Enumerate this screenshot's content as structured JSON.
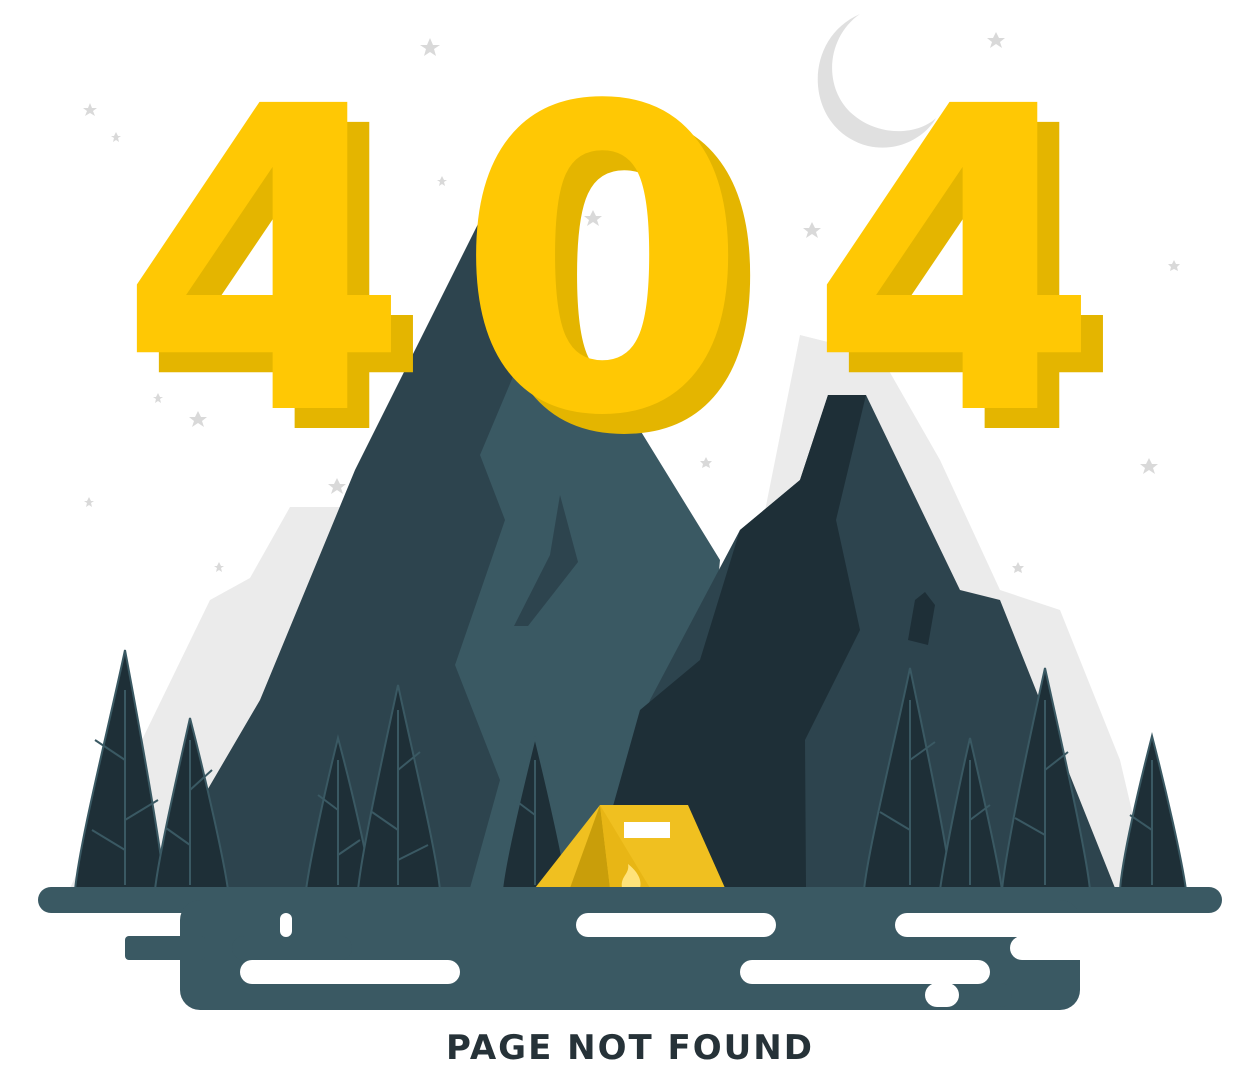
{
  "illustration": {
    "code": [
      "4",
      "0",
      "4"
    ],
    "caption": "PAGE NOT FOUND"
  },
  "colors": {
    "digit": "#ffc804",
    "digit_shadow": "#e4b500",
    "mountain_dark": "#1e2f37",
    "mountain_mid": "#2d444e",
    "mountain_light": "#3a5963",
    "mountain_back": "#ebebeb",
    "ground": "#3a5963",
    "tent": "#f0c020",
    "tent_shade": "#c99e0a",
    "star": "#d9d9d9",
    "moon": "#e0e0e0",
    "caption": "#263238"
  }
}
